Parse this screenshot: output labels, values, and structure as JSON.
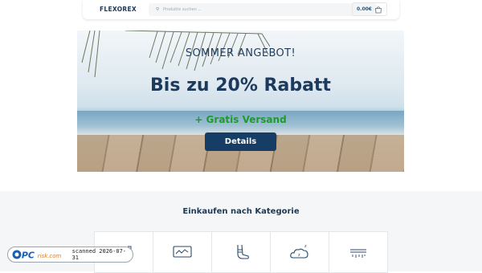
{
  "header": {
    "logo": "FLEXOREX",
    "search_placeholder": "Produkte suchen ...",
    "cart_amount": "0.00€"
  },
  "hero": {
    "line1": "SOMMER ANGEBOT!",
    "line2": "Bis zu 20% Rabatt",
    "line3": "+ Gratis Versand",
    "button_label": "Details",
    "colors": {
      "headline": "#1c3a5e",
      "shipping": "#1f9a2b",
      "button": "#163d66"
    }
  },
  "categories": {
    "title": "Einkaufen nach Kategorie",
    "items": [
      {
        "icon": "partial-category-icon"
      },
      {
        "icon": "monitor-chart-icon"
      },
      {
        "icon": "foot-bandage-icon"
      },
      {
        "icon": "sleep-cloud-icon"
      },
      {
        "icon": "heat-pad-icon"
      }
    ]
  },
  "watermark": {
    "brand": "PCrisk.com",
    "scan_text": "scanned 2026-07-31"
  }
}
